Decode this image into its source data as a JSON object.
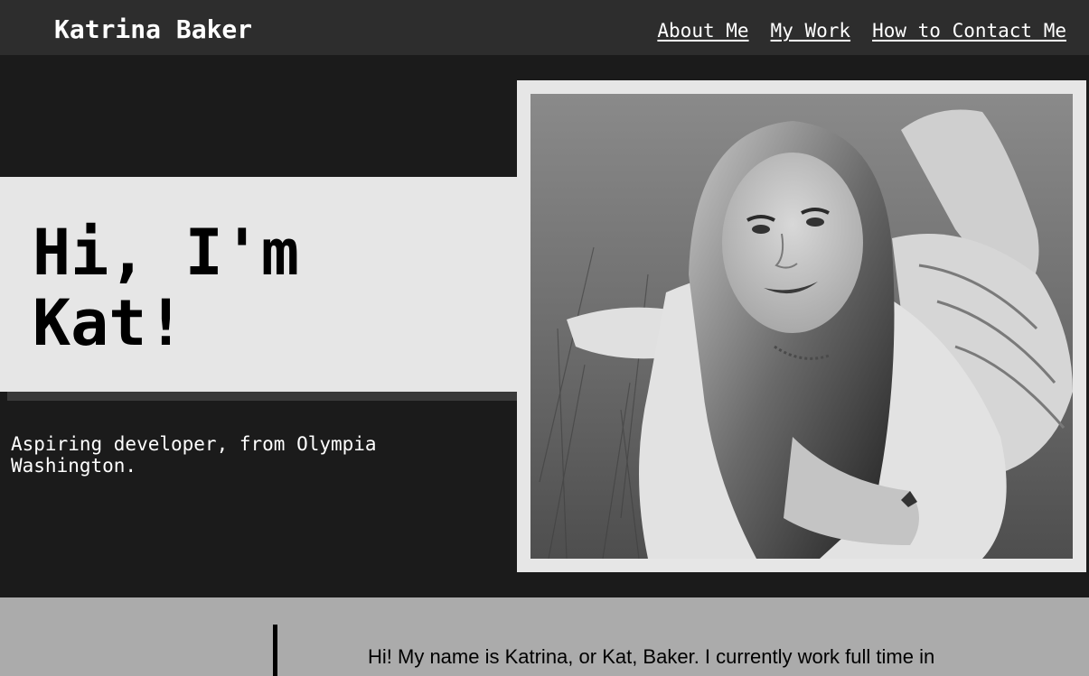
{
  "header": {
    "brand": "Katrina Baker",
    "nav": [
      "About Me",
      "My Work",
      "How to Contact Me"
    ]
  },
  "hero": {
    "greeting_line1": "Hi, I'm",
    "greeting_line2": "Kat!",
    "tagline": "Aspiring developer, from Olympia Washington."
  },
  "about": {
    "intro_text": "Hi! My name is Katrina, or Kat, Baker. I currently work full time in"
  },
  "colors": {
    "header_bg": "#2d2d2d",
    "page_bg": "#1b1b1b",
    "panel_light": "#e6e6e6",
    "about_bg": "#ababab"
  }
}
